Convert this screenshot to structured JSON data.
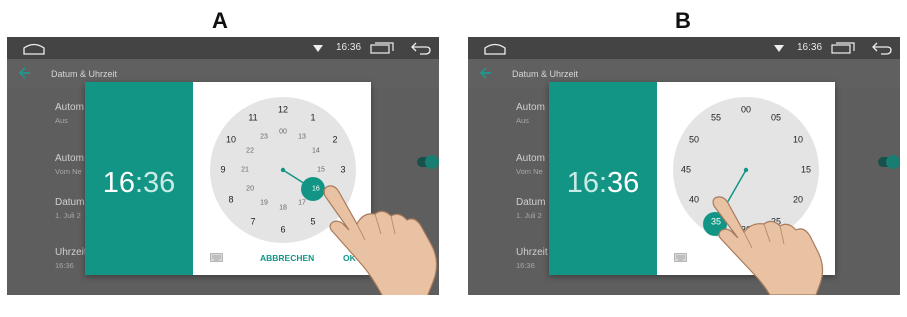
{
  "labels": {
    "a": "A",
    "b": "B"
  },
  "status_bar": {
    "time": "16:36"
  },
  "app_bar": {
    "title": "Datum & Uhrzeit"
  },
  "settings": [
    {
      "title": "Autom",
      "subtitle": "Aus"
    },
    {
      "title": "Autom",
      "subtitle": "Vom Ne"
    },
    {
      "title": "Datum",
      "subtitle": "1. Juli 2"
    },
    {
      "title": "Uhrzeit",
      "subtitle": "16:36"
    }
  ],
  "dialog": {
    "time_hours": "16",
    "time_sep": ":",
    "time_minutes": "36",
    "cancel": "ABBRECHEN",
    "ok": "OK"
  },
  "hour_outer": [
    "12",
    "1",
    "2",
    "3",
    "4",
    "5",
    "6",
    "7",
    "8",
    "9",
    "10",
    "11"
  ],
  "hour_inner": [
    "00",
    "13",
    "14",
    "15",
    "16",
    "17",
    "18",
    "19",
    "20",
    "21",
    "22",
    "23"
  ],
  "minutes": [
    "00",
    "05",
    "10",
    "15",
    "20",
    "25",
    "30",
    "35",
    "40",
    "45",
    "50",
    "55"
  ],
  "colors": {
    "accent": "#139585",
    "dialog_bg": "#ffffff",
    "clock_face": "#e4e4e4",
    "screen_bg": "#5e5e5e"
  },
  "icons": [
    "home-icon",
    "wifi-icon",
    "recents-icon",
    "back-icon",
    "back-arrow-icon",
    "keyboard-icon",
    "hand-pointer-icon"
  ]
}
